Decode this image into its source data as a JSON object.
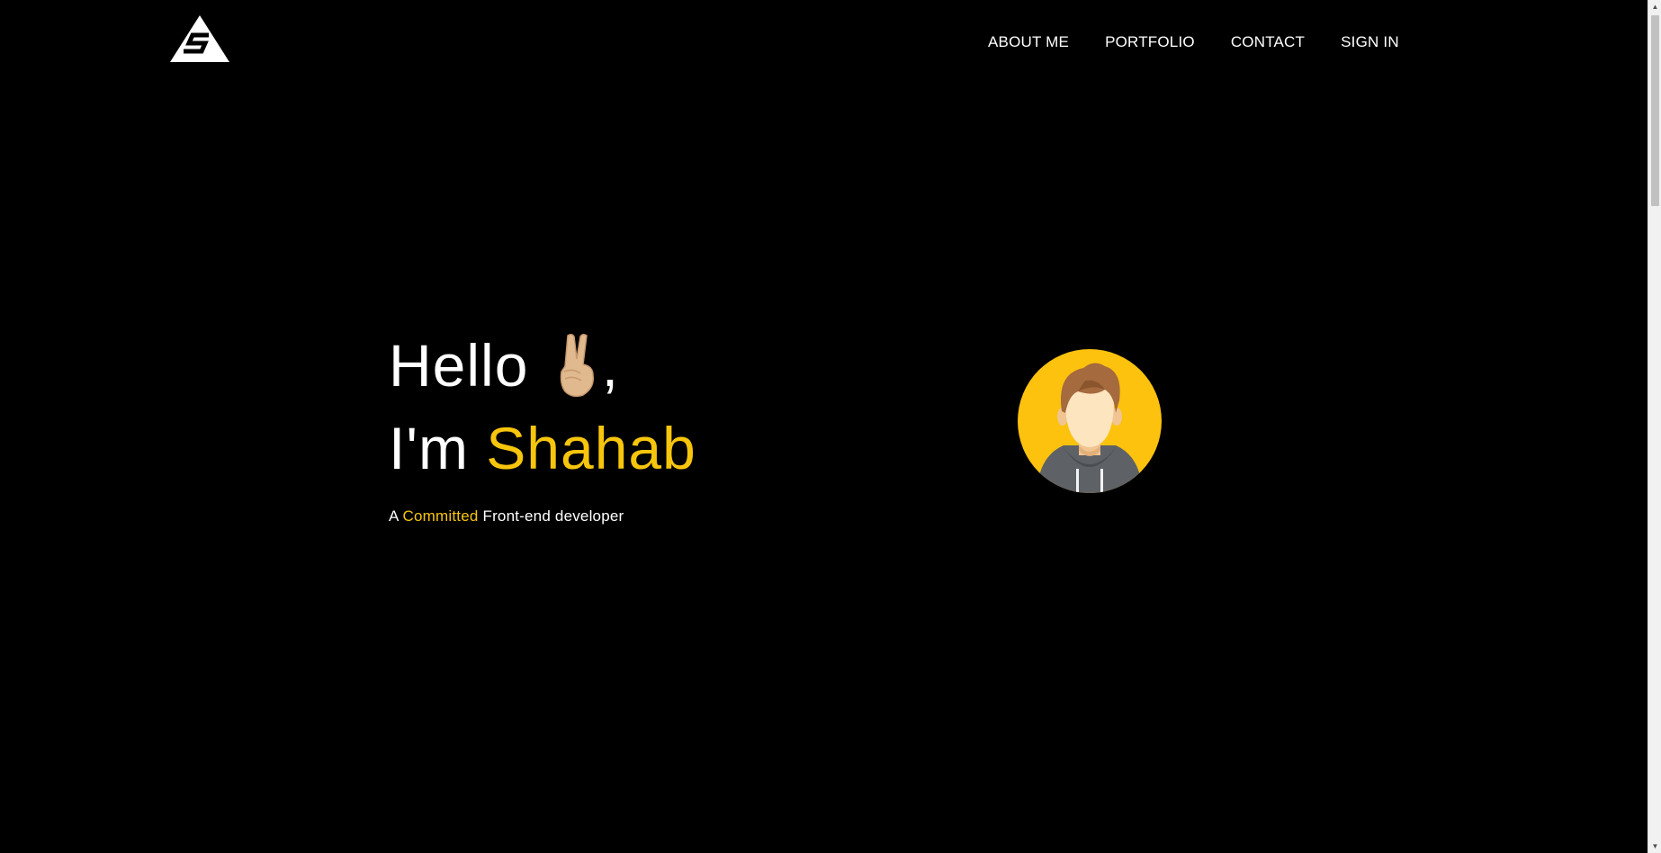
{
  "nav": {
    "items": [
      {
        "label": "ABOUT ME"
      },
      {
        "label": "PORTFOLIO"
      },
      {
        "label": "CONTACT"
      },
      {
        "label": "SIGN IN"
      }
    ]
  },
  "hero": {
    "greeting": "Hello",
    "greeting_suffix": ",",
    "intro_prefix": "I'm",
    "name": "Shahab",
    "tagline_prefix": "A",
    "tagline_accent": "Committed",
    "tagline_suffix": "Front-end developer"
  },
  "colors": {
    "background": "#000000",
    "accent": "#f7c50c",
    "text": "#ffffff"
  },
  "icons": {
    "logo": "triangle-s-logo",
    "greeting_emoji": "victory-hand-icon",
    "avatar": "avatar-illustration"
  }
}
